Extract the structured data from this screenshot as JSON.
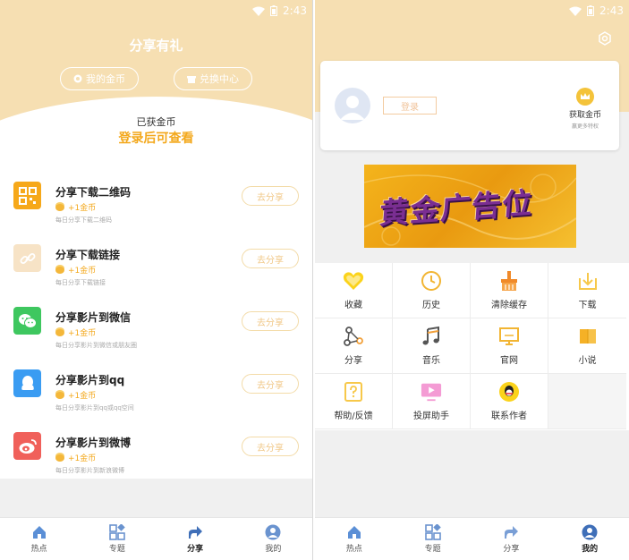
{
  "status_bar": {
    "time": "2:43"
  },
  "share_page": {
    "title": "分享有礼",
    "my_coins_label": "我的金币",
    "exchange_label": "兑换中心",
    "earned_label": "已获金币",
    "earned_value": "登录后可查看",
    "tasks": [
      {
        "title": "分享下载二维码",
        "reward": "+1金币",
        "desc": "每日分享下载二维码",
        "button": "去分享",
        "icon": "qrcode-icon"
      },
      {
        "title": "分享下载链接",
        "reward": "+1金币",
        "desc": "每日分享下载链接",
        "button": "去分享",
        "icon": "link-icon"
      },
      {
        "title": "分享影片到微信",
        "reward": "+1金币",
        "desc": "每日分享影片到微信或朋友圈",
        "button": "去分享",
        "icon": "wechat-icon"
      },
      {
        "title": "分享影片到qq",
        "reward": "+1金币",
        "desc": "每日分享影片到qq或qq空间",
        "button": "去分享",
        "icon": "qq-icon"
      },
      {
        "title": "分享影片到微博",
        "reward": "+1金币",
        "desc": "每日分享影片到新浪微博",
        "button": "去分享",
        "icon": "weibo-icon"
      }
    ]
  },
  "mine_page": {
    "login_label": "登录",
    "get_coins_label": "获取金币",
    "get_coins_sub": "赢更多特权",
    "ad_text": "黄金广告位",
    "grid": [
      {
        "label": "收藏",
        "icon": "heart-icon"
      },
      {
        "label": "历史",
        "icon": "clock-icon"
      },
      {
        "label": "清除缓存",
        "icon": "broom-icon"
      },
      {
        "label": "下载",
        "icon": "download-icon"
      },
      {
        "label": "分享",
        "icon": "share-icon"
      },
      {
        "label": "音乐",
        "icon": "music-icon"
      },
      {
        "label": "官网",
        "icon": "monitor-icon"
      },
      {
        "label": "小说",
        "icon": "book-icon"
      },
      {
        "label": "帮助/反馈",
        "icon": "help-icon"
      },
      {
        "label": "投屏助手",
        "icon": "cast-icon"
      },
      {
        "label": "联系作者",
        "icon": "qq-icon"
      }
    ]
  },
  "bottom_nav": {
    "items": [
      {
        "label": "热点",
        "icon": "home-icon"
      },
      {
        "label": "专题",
        "icon": "topics-icon"
      },
      {
        "label": "分享",
        "icon": "share-arrow-icon"
      },
      {
        "label": "我的",
        "icon": "user-icon"
      }
    ]
  },
  "colors": {
    "header_bg": "#f6dfb2",
    "accent": "#f3a81c",
    "nav_blue": "#4a78c8"
  }
}
